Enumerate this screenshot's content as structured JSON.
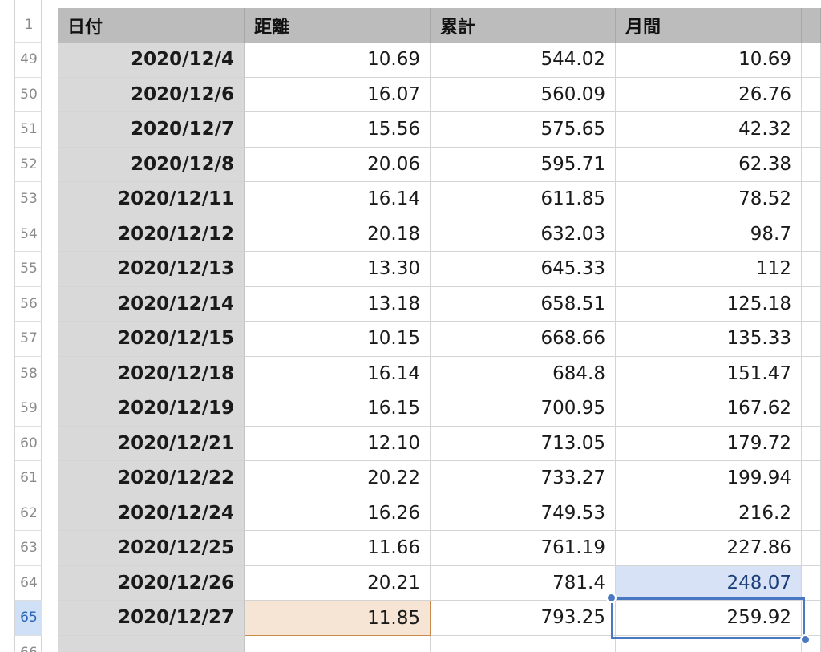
{
  "columns": [
    "日付",
    "距離",
    "累計",
    "月間"
  ],
  "header_row_number": "1",
  "rows": [
    {
      "n": "49",
      "date": "2020/12/4",
      "distance": "10.69",
      "total": "544.02",
      "monthly": "10.69"
    },
    {
      "n": "50",
      "date": "2020/12/6",
      "distance": "16.07",
      "total": "560.09",
      "monthly": "26.76"
    },
    {
      "n": "51",
      "date": "2020/12/7",
      "distance": "15.56",
      "total": "575.65",
      "monthly": "42.32"
    },
    {
      "n": "52",
      "date": "2020/12/8",
      "distance": "20.06",
      "total": "595.71",
      "monthly": "62.38"
    },
    {
      "n": "53",
      "date": "2020/12/11",
      "distance": "16.14",
      "total": "611.85",
      "monthly": "78.52"
    },
    {
      "n": "54",
      "date": "2020/12/12",
      "distance": "20.18",
      "total": "632.03",
      "monthly": "98.7"
    },
    {
      "n": "55",
      "date": "2020/12/13",
      "distance": "13.30",
      "total": "645.33",
      "monthly": "112"
    },
    {
      "n": "56",
      "date": "2020/12/14",
      "distance": "13.18",
      "total": "658.51",
      "monthly": "125.18"
    },
    {
      "n": "57",
      "date": "2020/12/15",
      "distance": "10.15",
      "total": "668.66",
      "monthly": "135.33"
    },
    {
      "n": "58",
      "date": "2020/12/18",
      "distance": "16.14",
      "total": "684.8",
      "monthly": "151.47"
    },
    {
      "n": "59",
      "date": "2020/12/19",
      "distance": "16.15",
      "total": "700.95",
      "monthly": "167.62"
    },
    {
      "n": "60",
      "date": "2020/12/21",
      "distance": "12.10",
      "total": "713.05",
      "monthly": "179.72"
    },
    {
      "n": "61",
      "date": "2020/12/22",
      "distance": "20.22",
      "total": "733.27",
      "monthly": "199.94"
    },
    {
      "n": "62",
      "date": "2020/12/24",
      "distance": "16.26",
      "total": "749.53",
      "monthly": "216.2"
    },
    {
      "n": "63",
      "date": "2020/12/25",
      "distance": "11.66",
      "total": "761.19",
      "monthly": "227.86"
    },
    {
      "n": "64",
      "date": "2020/12/26",
      "distance": "20.21",
      "total": "781.4",
      "monthly": "248.07"
    },
    {
      "n": "65",
      "date": "2020/12/27",
      "distance": "11.85",
      "total": "793.25",
      "monthly": "259.92"
    }
  ],
  "trailing_row_number": "66",
  "colors": {
    "header_bg": "#bcbcbc",
    "date_col_bg": "#d9d9d9",
    "selection_blue": "#4a78c2",
    "referenced_cell_orange": "#f6e4d4",
    "referenced_cell_blue": "#d8e2f6",
    "active_row_number": "#cfe0f7"
  }
}
